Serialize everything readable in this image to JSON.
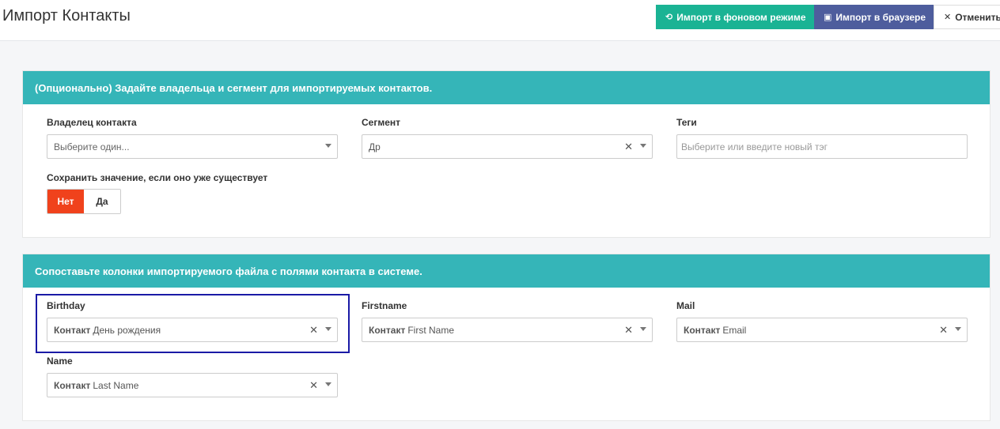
{
  "header": {
    "title": "Импорт Контакты",
    "actions": {
      "background_import": {
        "icon": "history-icon",
        "label": "Импорт в фоновом режиме"
      },
      "browser_import": {
        "icon": "browser-window-icon",
        "label": "Импорт в браузере"
      },
      "cancel": {
        "icon": "close-icon",
        "label": "Отменить"
      }
    }
  },
  "owner_panel": {
    "heading": "(Опционально) Задайте владельца и сегмент для импортируемых контактов.",
    "owner": {
      "label": "Владелец контакта",
      "placeholder": "Выберите один..."
    },
    "segment": {
      "label": "Сегмент",
      "value": "Др"
    },
    "tags": {
      "label": "Теги",
      "placeholder": "Выберите или введите новый тэг"
    },
    "keep_existing": {
      "label": "Сохранить значение, если оно уже существует",
      "no": "Нет",
      "yes": "Да",
      "selected": "Нет"
    }
  },
  "mapping_panel": {
    "heading": "Сопоставьте колонки импортируемого файла с полями контакта в системе.",
    "fields": [
      {
        "column": "Birthday",
        "entity": "Контакт",
        "field": "День рождения"
      },
      {
        "column": "Firstname",
        "entity": "Контакт",
        "field": "First Name"
      },
      {
        "column": "Mail",
        "entity": "Контакт",
        "field": "Email"
      },
      {
        "column": "Name",
        "entity": "Контакт",
        "field": "Last Name"
      }
    ]
  },
  "colors": {
    "panel_header": "#35b5b8",
    "btn_background_import": "#1ab394",
    "btn_browser_import": "#4e5d9d",
    "toggle_active": "#f0421c",
    "focus_outline": "#1a1aa6"
  }
}
